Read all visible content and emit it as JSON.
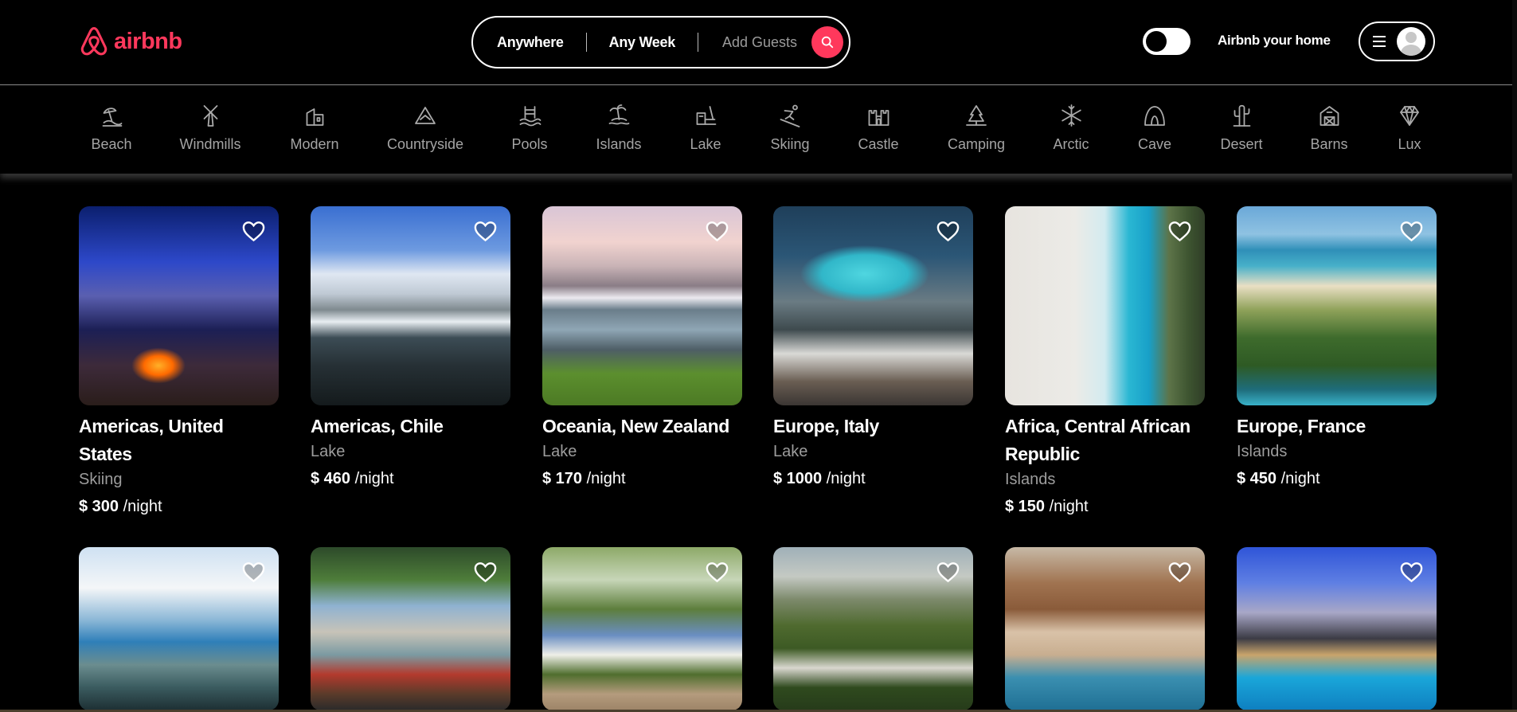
{
  "brand": {
    "name": "airbnb",
    "accent": "#ff385c"
  },
  "search": {
    "location": "Anywhere",
    "dates": "Any Week",
    "guests_placeholder": "Add Guests",
    "button_icon": "search-icon"
  },
  "header": {
    "theme_toggle_icon": "toggle-switch",
    "host_link": "Airbnb your home",
    "menu_icon": "hamburger-icon",
    "avatar_icon": "user-avatar-icon"
  },
  "categories": [
    {
      "label": "Beach",
      "icon": "beach-icon"
    },
    {
      "label": "Windmills",
      "icon": "windmill-icon"
    },
    {
      "label": "Modern",
      "icon": "modern-house-icon"
    },
    {
      "label": "Countryside",
      "icon": "countryside-icon"
    },
    {
      "label": "Pools",
      "icon": "pool-icon"
    },
    {
      "label": "Islands",
      "icon": "island-icon"
    },
    {
      "label": "Lake",
      "icon": "lake-icon"
    },
    {
      "label": "Skiing",
      "icon": "skiing-icon"
    },
    {
      "label": "Castle",
      "icon": "castle-icon"
    },
    {
      "label": "Camping",
      "icon": "camping-icon"
    },
    {
      "label": "Arctic",
      "icon": "snowflake-icon"
    },
    {
      "label": "Cave",
      "icon": "cave-icon"
    },
    {
      "label": "Desert",
      "icon": "cactus-icon"
    },
    {
      "label": "Barns",
      "icon": "barn-icon"
    },
    {
      "label": "Lux",
      "icon": "diamond-icon"
    }
  ],
  "listings": [
    {
      "title": "Americas, United States",
      "category": "Skiing",
      "price": "$ 300",
      "per": "/night"
    },
    {
      "title": "Americas, Chile",
      "category": "Lake",
      "price": "$ 460",
      "per": "/night"
    },
    {
      "title": "Oceania, New Zealand",
      "category": "Lake",
      "price": "$ 170",
      "per": "/night"
    },
    {
      "title": "Europe, Italy",
      "category": "Lake",
      "price": "$ 1000",
      "per": "/night"
    },
    {
      "title": "Africa, Central African Republic",
      "category": "Islands",
      "price": "$ 150",
      "per": "/night"
    },
    {
      "title": "Europe, France",
      "category": "Islands",
      "price": "$ 450",
      "per": "/night"
    },
    {
      "title": "",
      "category": "",
      "price": "",
      "per": ""
    },
    {
      "title": "",
      "category": "",
      "price": "",
      "per": ""
    },
    {
      "title": "",
      "category": "",
      "price": "",
      "per": ""
    },
    {
      "title": "",
      "category": "",
      "price": "",
      "per": ""
    },
    {
      "title": "",
      "category": "",
      "price": "",
      "per": ""
    },
    {
      "title": "",
      "category": "",
      "price": "",
      "per": ""
    }
  ]
}
